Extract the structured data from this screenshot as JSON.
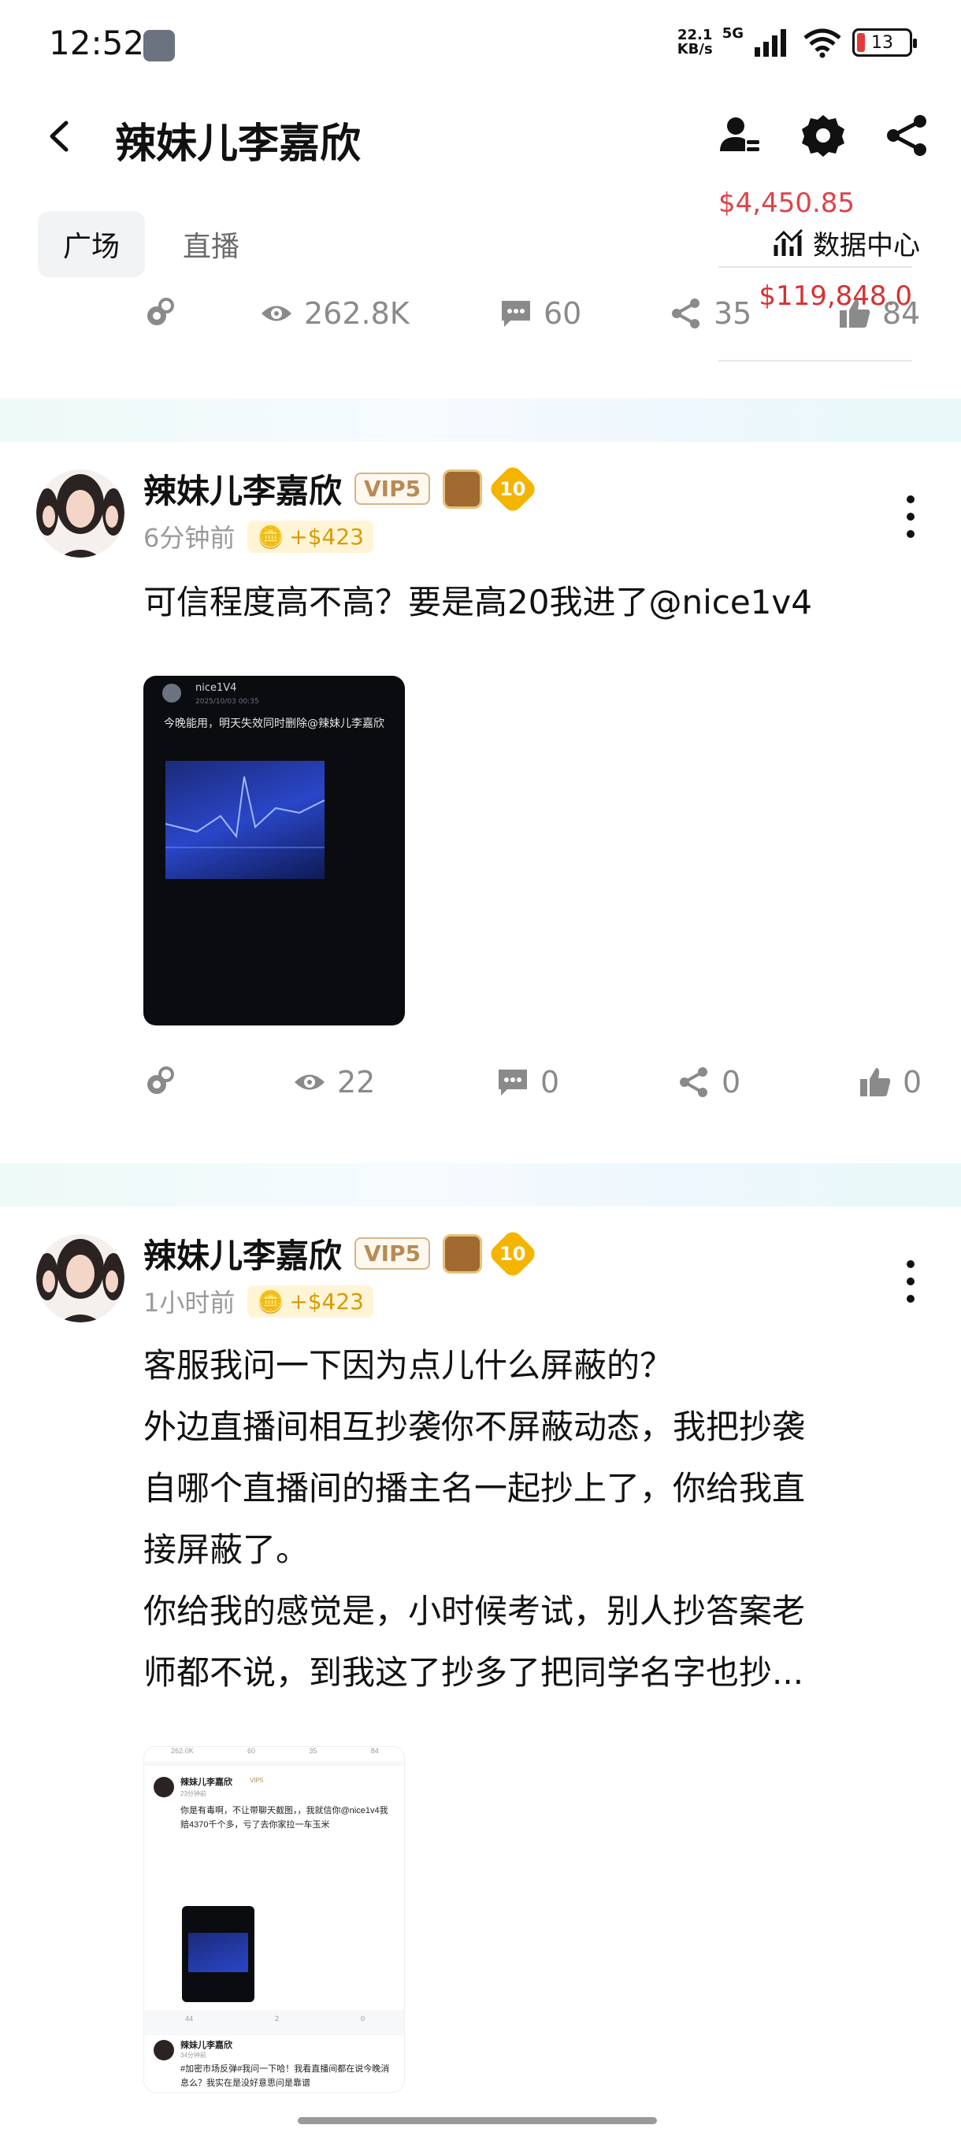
{
  "status_bar": {
    "time": "12:52",
    "net_speed_top": "22.1",
    "net_speed_bottom": "KB/s",
    "network": "5G",
    "battery": "13"
  },
  "header": {
    "title": "辣妹儿李嘉欣"
  },
  "tabs": [
    {
      "label": "广场",
      "active": true
    },
    {
      "label": "直播",
      "active": false
    }
  ],
  "summary": {
    "money_1": "$4,450.85",
    "data_center": "数据中心",
    "money_2": "$119,848.0",
    "views": "262.8K",
    "comments": "60",
    "shares": "35",
    "likes": "84"
  },
  "posts": [
    {
      "author": "辣妹儿李嘉欣",
      "vip": "VIP5",
      "level": "10",
      "time": "6分钟前",
      "tip": "+$423",
      "text": "可信程度高不高？要是高20我进了@nice1v4",
      "image": {
        "inner_user": "nice1V4",
        "inner_date": "2025/10/03 00:35",
        "inner_text": "今晚能用，明天失效同时删除@辣妹儿李嘉欣"
      },
      "views": "22",
      "comments": "0",
      "shares": "0",
      "likes": "0"
    },
    {
      "author": "辣妹儿李嘉欣",
      "vip": "VIP5",
      "level": "10",
      "time": "1小时前",
      "tip": "+$423",
      "text_lines": [
        "客服我问一下因为点儿什么屏蔽的？",
        "外边直播间相互抄袭你不屏蔽动态，我把抄袭",
        "自哪个直播间的播主名一起抄上了，你给我直",
        "接屏蔽了。",
        "你给我的感觉是，小时候考试，别人抄答案老",
        "师都不说，到我这了抄多了把同学名字也抄..."
      ],
      "thumb": {
        "stats": [
          "262.0K",
          "60",
          "35",
          "84"
        ],
        "author": "辣妹儿李嘉欣",
        "vip": "VIP5",
        "time": "23分钟前",
        "text": "你是有毒啊，不让带聊天截图，，我就信你@nice1v4我赔4370千个多，亏了去你家拉一车玉米",
        "stats2": [
          "44",
          "2",
          "0"
        ],
        "author2": "辣妹儿李嘉欣",
        "time2": "34分钟前",
        "text2": "#加密市场反弹#我问一下哈！我看直播间都在说今晚消息么？我实在是没好意思问是靠谱"
      }
    }
  ],
  "colors": {
    "accent_red": "#e0424a",
    "gold": "#f5b400",
    "muted": "#8a8a8a"
  }
}
